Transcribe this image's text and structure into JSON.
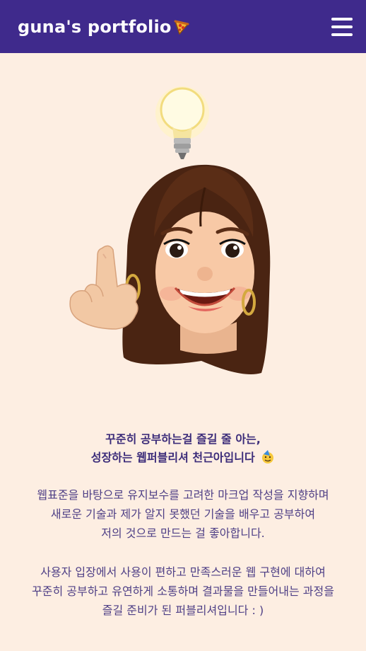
{
  "header": {
    "brand": "guna's portfolio",
    "brand_icon": "pizza-icon",
    "menu_icon": "hamburger-menu-icon",
    "colors": {
      "bar": "#3f2a8c",
      "text": "#ffffff"
    }
  },
  "hero": {
    "image": "memoji-avatar-with-lightbulb",
    "icons": [
      "lightbulb-icon",
      "memoji-avatar"
    ]
  },
  "intro": {
    "headline_line1": "꾸준히 공부하는걸 즐길 줄 아는,",
    "headline_line2": "성장하는 웹퍼블리셔 천근아입니다",
    "headline_emoji": "face-with-party-hat-emoji",
    "paragraph1": [
      "웹표준을 바탕으로 유지보수를 고려한 마크업 작성을 지향하며",
      "새로운 기술과 제가 알지 못했던 기술을 배우고 공부하여",
      "저의 것으로 만드는 걸 좋아합니다."
    ],
    "paragraph2": [
      "사용자 입장에서 사용이 편하고 만족스러운 웹 구현에 대하여",
      "꾸준히 공부하고 유연하게 소통하며 결과물을 만들어내는 과정을",
      "즐길 준비가 된 퍼블리셔입니다 : )"
    ]
  },
  "colors": {
    "background": "#fdeee2",
    "accent": "#3f2a8c",
    "text": "#3c2c7a"
  }
}
